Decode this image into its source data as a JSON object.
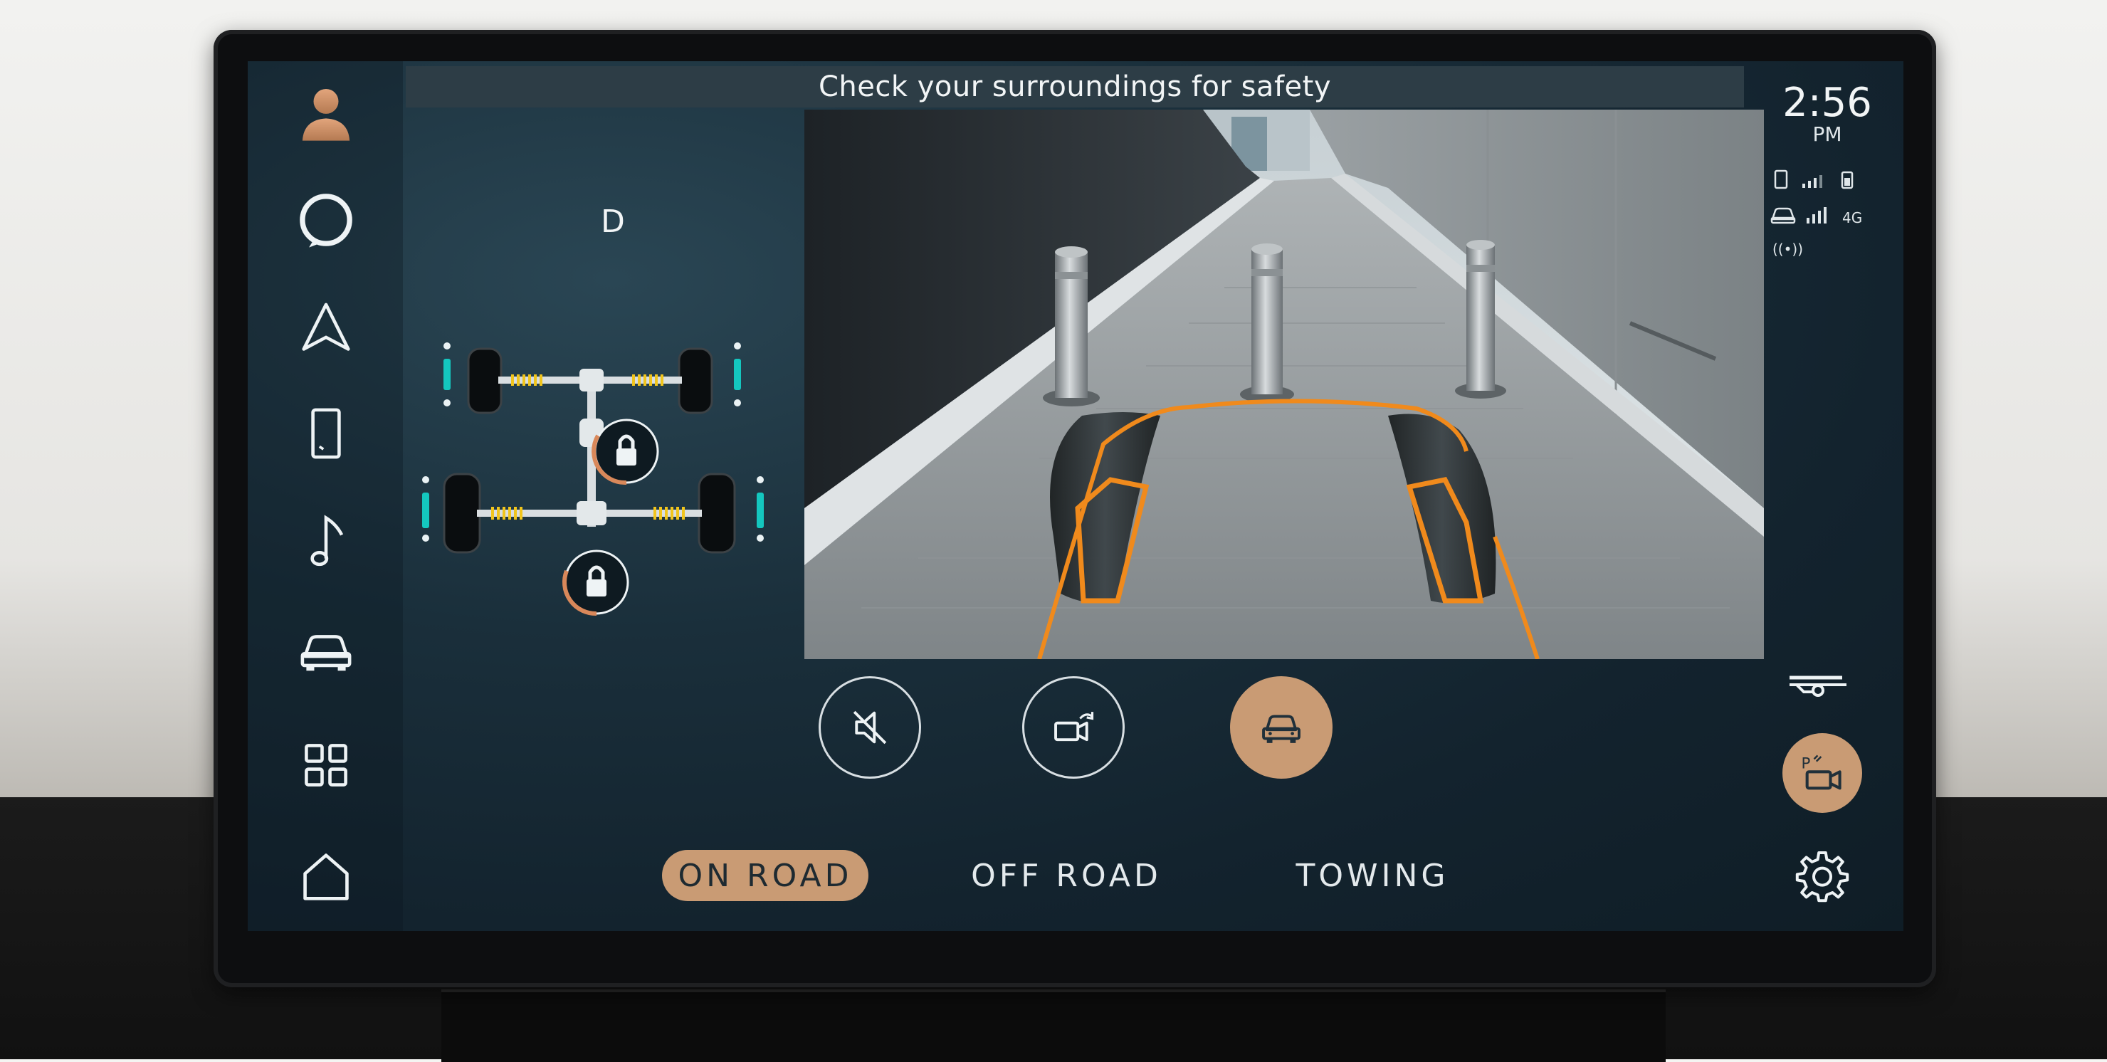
{
  "banner": {
    "text": "Check your surroundings for safety"
  },
  "status": {
    "time": "2:56",
    "ampm": "PM",
    "network": "4G",
    "wifi": "((•))"
  },
  "drivetrain": {
    "gear": "D",
    "front_diff": "locked",
    "rear_diff": "locked"
  },
  "nav": {
    "items": [
      {
        "name": "profile",
        "icon": "user-avatar-icon"
      },
      {
        "name": "alexa",
        "icon": "alexa-ring-icon"
      },
      {
        "name": "navigation",
        "icon": "navigation-arrow-icon"
      },
      {
        "name": "phone",
        "icon": "phone-icon"
      },
      {
        "name": "media",
        "icon": "music-note-icon"
      },
      {
        "name": "vehicle",
        "icon": "car-icon"
      },
      {
        "name": "apps",
        "icon": "app-grid-icon"
      },
      {
        "name": "home",
        "icon": "home-icon"
      }
    ]
  },
  "controls": [
    {
      "name": "mute",
      "icon": "speaker-mute-icon",
      "active": false
    },
    {
      "name": "camera-views",
      "icon": "camera-rotate-icon",
      "active": false
    },
    {
      "name": "vehicle-view",
      "icon": "car-front-icon",
      "active": true
    }
  ],
  "modes": {
    "tabs": [
      {
        "label": "ON ROAD",
        "active": true
      },
      {
        "label": "OFF ROAD",
        "active": false
      },
      {
        "label": "TOWING",
        "active": false
      }
    ]
  },
  "right_actions": [
    {
      "name": "tow-hitch",
      "icon": "tow-hitch-icon"
    },
    {
      "name": "park-camera",
      "icon": "park-camera-icon",
      "label": "P"
    },
    {
      "name": "settings",
      "icon": "gear-icon"
    }
  ],
  "colors": {
    "accent": "#c99b74",
    "screen_bg": "#162a35",
    "guide_line": "#f08a1c",
    "indicator_teal": "#14c7bf"
  }
}
